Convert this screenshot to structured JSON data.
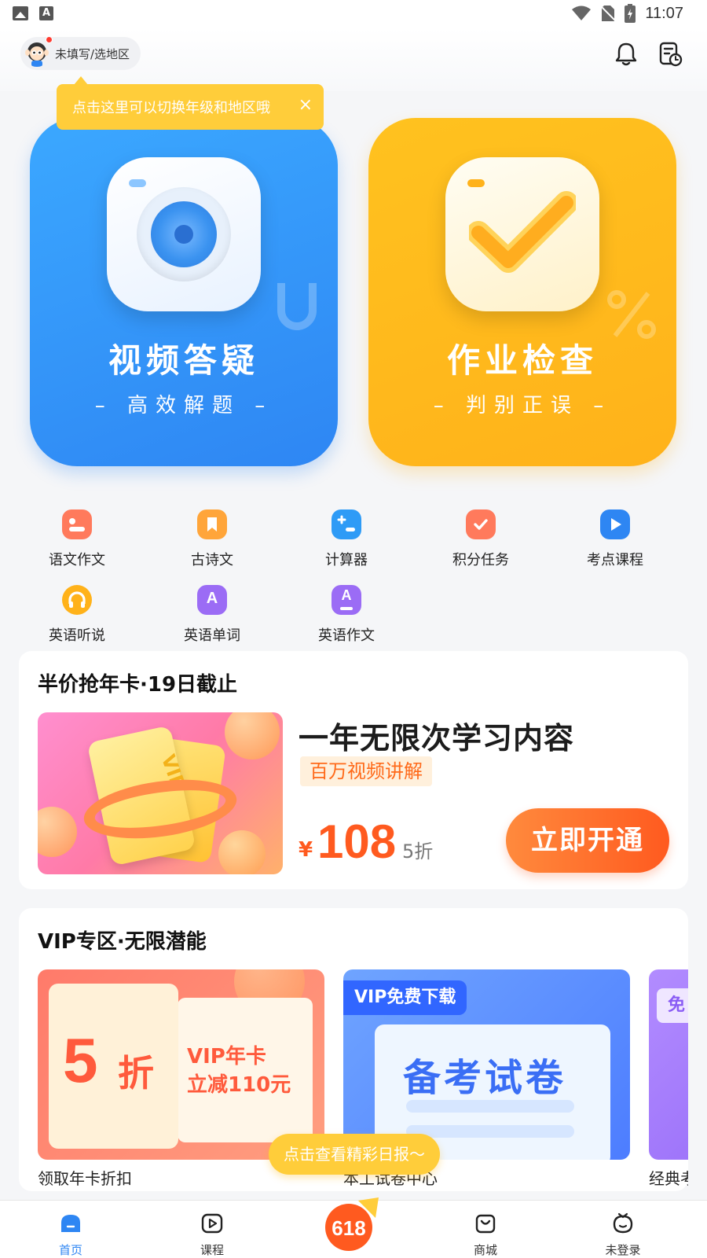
{
  "status_bar": {
    "time": "11:07"
  },
  "header": {
    "region_label": "未填写/选地区"
  },
  "tooltip": {
    "text": "点击这里可以切换年级和地区哦",
    "close": "×"
  },
  "hero_cards": [
    {
      "title": "视频答疑",
      "subtitle": "– 高效解题 –",
      "color": "#2e86f3"
    },
    {
      "title": "作业检查",
      "subtitle": "– 判别正误 –",
      "color": "#ffb21a"
    }
  ],
  "quick_tools": [
    {
      "label": "语文作文",
      "icon": "essay-icon",
      "color": "#ff7a5c"
    },
    {
      "label": "古诗文",
      "icon": "bookmark-icon",
      "color": "#ffa53a"
    },
    {
      "label": "计算器",
      "icon": "calculator-icon",
      "color": "#2e9bf6"
    },
    {
      "label": "积分任务",
      "icon": "task-bag-icon",
      "color": "#ff7a5c"
    },
    {
      "label": "考点课程",
      "icon": "play-icon",
      "color": "#2e86f3"
    },
    {
      "label": "英语听说",
      "icon": "headphones-icon",
      "color": "#ffb21a"
    },
    {
      "label": "英语单词",
      "icon": "letter-a-icon",
      "color": "#9b6cf5"
    },
    {
      "label": "英语作文",
      "icon": "letter-a-pen-icon",
      "color": "#9b6cf5"
    }
  ],
  "promo": {
    "section_title": "半价抢年卡·19日截止",
    "image_text": "VIP",
    "headline": "一年无限次学习内容",
    "tag": "百万视频讲解",
    "currency": "¥",
    "price": "108",
    "discount": "5折",
    "button": "立即开通"
  },
  "vip_zone": {
    "section_title": "VIP专区·无限潜能",
    "cards": [
      {
        "big": "5",
        "zhe": "折",
        "line1": "VIP年卡",
        "line2": "立减110元",
        "caption": "领取年卡折扣"
      },
      {
        "badge": "VIP免费下载",
        "title": "备考试卷",
        "caption": "本工试卷中心"
      },
      {
        "badge": "免",
        "caption": "经典考"
      }
    ]
  },
  "floating_pill": "点击查看精彩日报～",
  "tabbar": {
    "items": [
      {
        "label": "首页"
      },
      {
        "label": "课程"
      },
      {
        "label": "618"
      },
      {
        "label": "商城"
      },
      {
        "label": "未登录"
      }
    ]
  },
  "colors": {
    "primary": "#2e86f3",
    "accent": "#ffb21a",
    "price": "#ff5a1f"
  }
}
